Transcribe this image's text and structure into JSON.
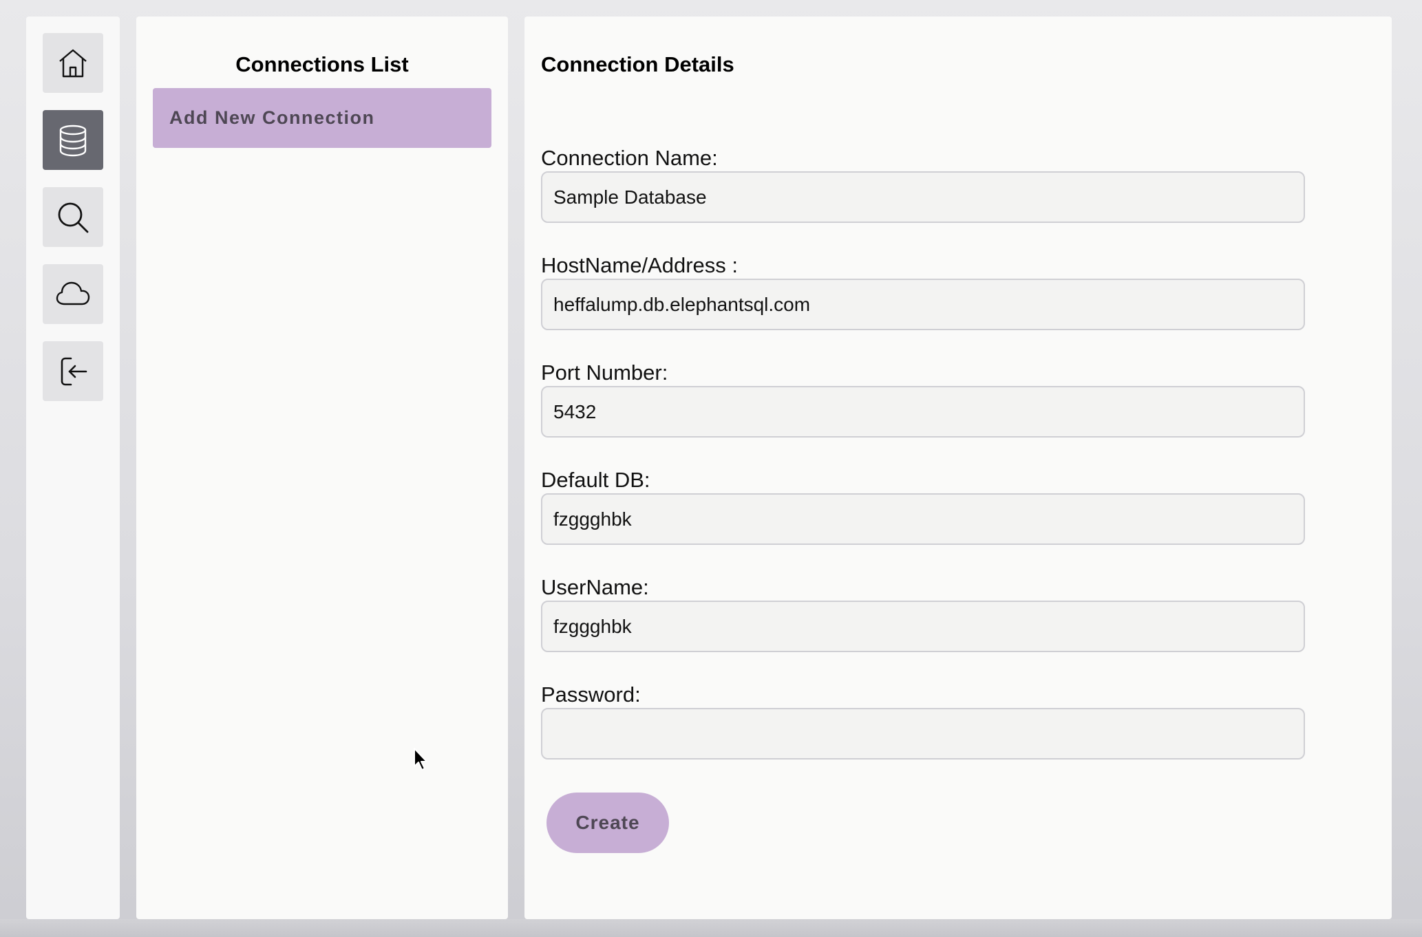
{
  "sidebar": {
    "items": [
      {
        "name": "home",
        "icon": "home-icon",
        "active": false
      },
      {
        "name": "database",
        "icon": "database-icon",
        "active": true
      },
      {
        "name": "search",
        "icon": "search-icon",
        "active": false
      },
      {
        "name": "cloud",
        "icon": "cloud-icon",
        "active": false
      },
      {
        "name": "logout",
        "icon": "logout-icon",
        "active": false
      }
    ]
  },
  "connections_list": {
    "title": "Connections List",
    "add_button_label": "Add New Connection"
  },
  "connection_details": {
    "title": "Connection Details",
    "fields": {
      "connection_name": {
        "label": "Connection Name:",
        "value": "Sample Database"
      },
      "hostname": {
        "label": "HostName/Address :",
        "value": "heffalump.db.elephantsql.com"
      },
      "port": {
        "label": "Port Number:",
        "value": "5432"
      },
      "default_db": {
        "label": "Default DB:",
        "value": "fzggghbk"
      },
      "username": {
        "label": "UserName:",
        "value": "fzggghbk"
      },
      "password": {
        "label": "Password:",
        "value": ""
      }
    },
    "create_button_label": "Create"
  },
  "colors": {
    "accent": "#c7aed5",
    "accent_text": "#4e4754",
    "active_nav": "#676870"
  }
}
